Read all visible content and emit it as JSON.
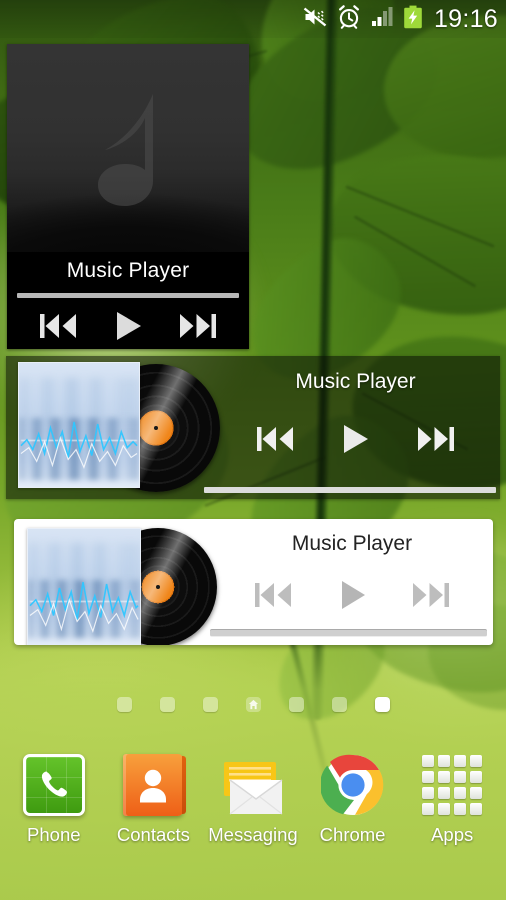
{
  "statusbar": {
    "time": "19:16",
    "icons": [
      {
        "name": "mute-vibrate-icon",
        "label": "Sound muted"
      },
      {
        "name": "alarm-clock-icon",
        "label": "Alarm set"
      },
      {
        "name": "signal-bars-icon",
        "label": "Signal strength"
      },
      {
        "name": "battery-charging-icon",
        "label": "Battery charging"
      }
    ]
  },
  "widgets": {
    "dark": {
      "title": "Music Player",
      "progress_percent": 100,
      "controls": {
        "previous_label": "Previous",
        "play_label": "Play",
        "next_label": "Next"
      }
    },
    "translucent": {
      "title": "Music Player",
      "progress_percent": 100,
      "controls": {
        "previous_label": "Previous",
        "play_label": "Play",
        "next_label": "Next"
      }
    },
    "light": {
      "title": "Music Player",
      "progress_percent": 100,
      "controls": {
        "previous_label": "Previous",
        "play_label": "Play",
        "next_label": "Next"
      }
    }
  },
  "page_indicator": {
    "total": 7,
    "active_index": 6,
    "home_index": 3,
    "pages": [
      {
        "type": "dot",
        "active": false
      },
      {
        "type": "dot",
        "active": false
      },
      {
        "type": "dot",
        "active": false
      },
      {
        "type": "home",
        "active": false
      },
      {
        "type": "dot",
        "active": false
      },
      {
        "type": "dot",
        "active": false
      },
      {
        "type": "dot",
        "active": true
      }
    ]
  },
  "dock": {
    "items": [
      {
        "label": "Phone",
        "icon": "phone-icon"
      },
      {
        "label": "Contacts",
        "icon": "contacts-icon"
      },
      {
        "label": "Messaging",
        "icon": "messaging-icon"
      },
      {
        "label": "Chrome",
        "icon": "chrome-icon"
      },
      {
        "label": "Apps",
        "icon": "apps-grid-icon"
      }
    ]
  },
  "colors": {
    "wallpaper_green_dark": "#2e5210",
    "wallpaper_green_light": "#b5d154",
    "status_text": "#ffffff",
    "widget_dark_bg": "#000000",
    "widget_light_bg": "#ffffff",
    "phone_green": "#4aab16",
    "contacts_orange": "#ee5f17",
    "messaging_yellow": "#f9c61d",
    "chrome_red": "#e8453c",
    "chrome_blue": "#4a8ef0",
    "vinyl_label_orange": "#f0861a"
  }
}
